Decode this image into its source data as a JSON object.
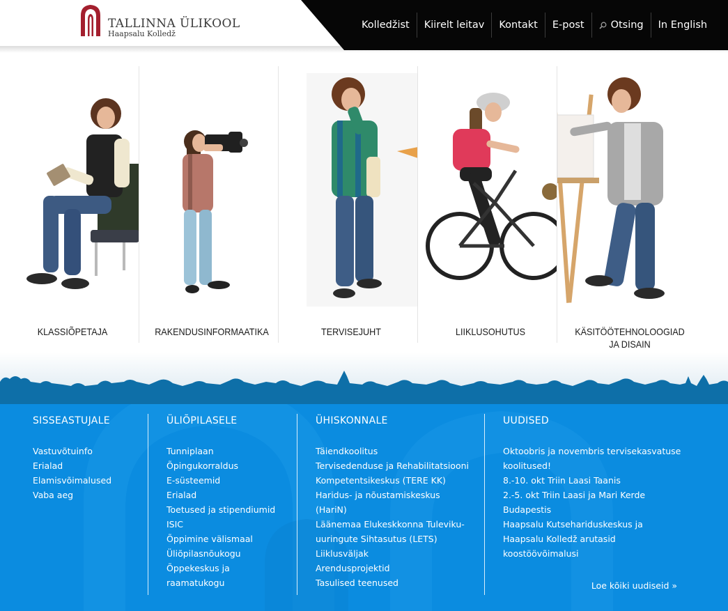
{
  "header": {
    "logo_title": "TALLINNA ÜLIKOOL",
    "logo_subtitle": "Haapsalu Kolledž",
    "nav": [
      "Kolledžist",
      "Kiirelt leitav",
      "Kontakt",
      "E-post",
      "Otsing",
      "In English"
    ]
  },
  "programs": [
    {
      "label": "KLASSIÕPETAJA"
    },
    {
      "label": "RAKENDUSINFORMAATIKA"
    },
    {
      "label": "TERVISEJUHT"
    },
    {
      "label": "LIIKLUSOHUTUS"
    },
    {
      "label": "KÄSITÖÖTEHNOLOOGIAD\nJA DISAIN"
    }
  ],
  "footer": {
    "sisseastujale": {
      "title": "SISSEASTUJALE",
      "links": [
        "Vastuvõtuinfo",
        "Erialad",
        "Elamisvõimalused",
        "Vaba aeg"
      ]
    },
    "uliopilasele": {
      "title": "ÜLIÕPILASELE",
      "links": [
        "Tunniplaan",
        "Õpingukorraldus",
        "E-süsteemid",
        "Erialad",
        "Toetused ja stipendiumid",
        "ISIC",
        "Õppimine välismaal",
        "Üliõpilasnõukogu",
        "Õppekeskus ja",
        "raamatukogu"
      ]
    },
    "uhiskonnale": {
      "title": "ÜHISKONNALE",
      "links": [
        "Täiendkoolitus",
        "Tervisedenduse ja Rehabilitatsiooni",
        "Kompetentsikeskus (TERE KK)",
        "Haridus- ja nõustamiskeskus",
        "(HariN)",
        "Läänemaa Elukeskkonna Tuleviku-",
        "uuringute Sihtasutus (LETS)",
        "Liiklusväljak",
        "Arendusprojektid",
        "Tasulised teenused"
      ]
    },
    "uudised": {
      "title": "UUDISED",
      "links": [
        "Oktoobris ja novembris tervisekasvatuse",
        "koolitused!",
        "8.-10. okt Triin Laasi Taanis",
        "2.-5. okt Triin Laasi ja Mari Kerde",
        "Budapestis",
        "Haapsalu Kutsehariduskeskus ja",
        "Haapsalu Kolledž arutasid",
        "koostöövõimalusi"
      ],
      "read_all": "Loe kõiki uudiseid »"
    }
  },
  "colors": {
    "footer_blue": "#0b8ce0",
    "skyline_blue": "#0e6fa8",
    "logo_red": "#a31f2e",
    "nav_black": "#060606"
  }
}
